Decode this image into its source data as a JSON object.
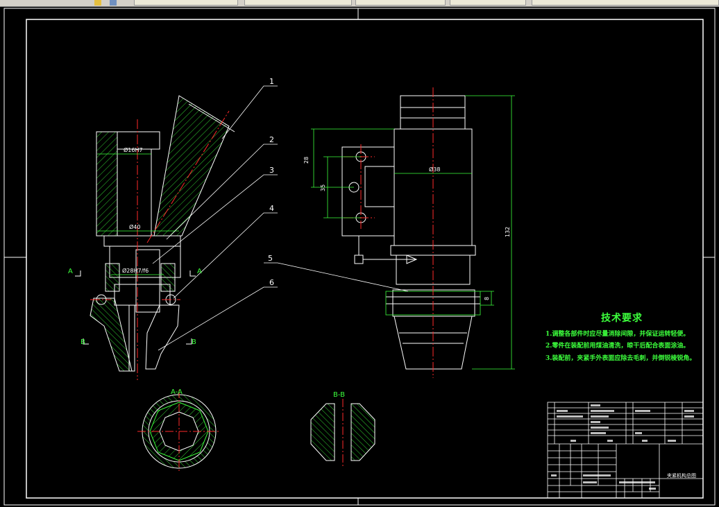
{
  "window": {
    "tabs": [
      "",
      "",
      "",
      "",
      ""
    ]
  },
  "drawing": {
    "colors": {
      "background": "#000000",
      "outline": "#ffffff",
      "dimension": "#3cff3c",
      "centerline": "#ff2a2a",
      "hatch": "#3cff3c"
    },
    "part_numbers": [
      "1",
      "2",
      "3",
      "4",
      "5",
      "6"
    ],
    "dims": {
      "bore_top": "Ø16H7",
      "dia_40": "Ø40",
      "dia_28": "Ø28H7/f6",
      "height_28": "28",
      "height_35": "35",
      "dia_38": "Ø38",
      "height_132": "132",
      "height_8": "8"
    },
    "section_marks": {
      "a_left": "A",
      "a_right": "A",
      "b_left": "B",
      "b_right": "B",
      "section_aa": "A-A",
      "section_bb": "B-B"
    },
    "tech_requirements": {
      "title": "技术要求",
      "lines": [
        "1.调整各部件时应尽量消除间隙，并保证运转轻便。",
        "2.零件在装配前用煤油清洗，晾干后配合表面涂油。",
        "3.装配前，夹紧手外表面应除去毛刺，并倒锐棱锐角。"
      ]
    },
    "title_block": {
      "drawing_name": "夹紧机构总图"
    }
  }
}
